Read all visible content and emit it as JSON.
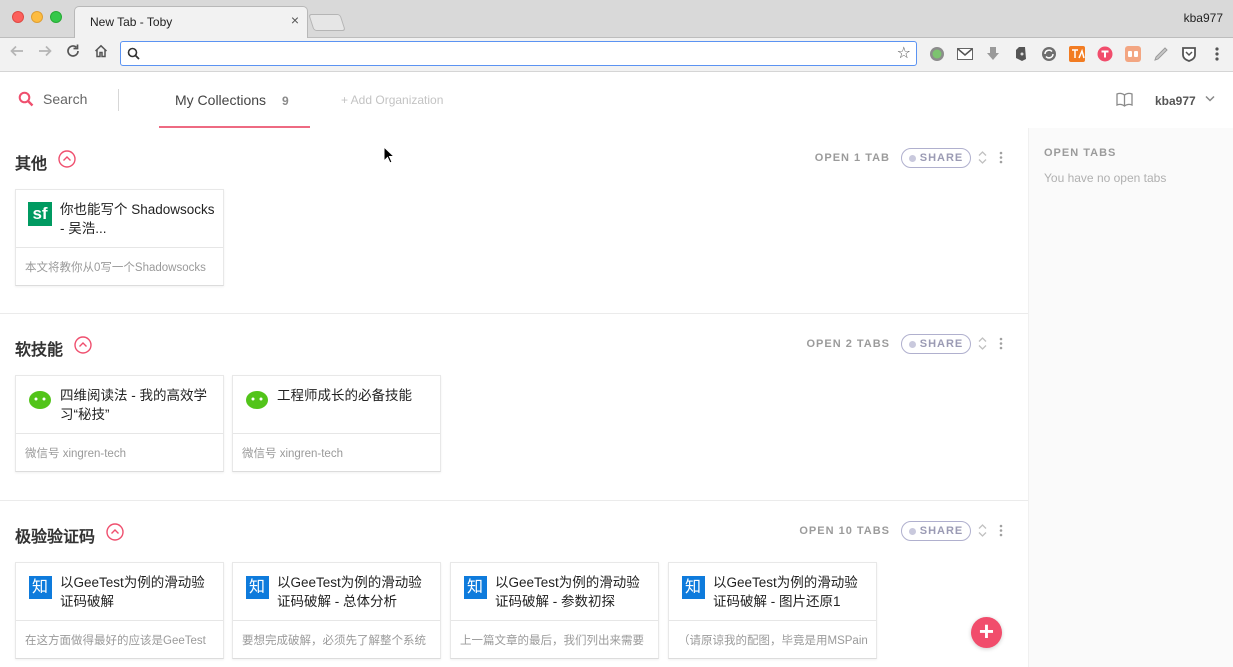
{
  "browser": {
    "tab_title": "New Tab - Toby",
    "tab_close": "×",
    "profile_name": "kba977",
    "address_value": "",
    "extension_icons": [
      "grammarly-icon",
      "gmail-icon",
      "download-icon",
      "evernote-icon",
      "sync-icon",
      "translate-icon",
      "toby-icon",
      "reader-icon",
      "highlighter-icon",
      "shield-icon"
    ]
  },
  "header": {
    "search_label": "Search",
    "collections_label": "My Collections",
    "collections_count": "9",
    "add_org_label": "+ Add Organization",
    "user_name": "kba977"
  },
  "collections": [
    {
      "title": "其他",
      "open_label": "OPEN 1 TAB",
      "share_label": "SHARE",
      "cards": [
        {
          "icon": "segmentfault-icon",
          "title": "你也能写个 Shadowsocks - 吴浩...",
          "desc": "本文将教你从0写一个Shadowsocks"
        }
      ]
    },
    {
      "title": "软技能",
      "open_label": "OPEN 2 TABS",
      "share_label": "SHARE",
      "cards": [
        {
          "icon": "wechat-icon",
          "title": "四维阅读法 - 我的高效学习“秘技”",
          "desc": "微信号 xingren-tech"
        },
        {
          "icon": "wechat-icon",
          "title": "工程师成长的必备技能",
          "desc": "微信号 xingren-tech"
        }
      ]
    },
    {
      "title": "极验验证码",
      "open_label": "OPEN 10 TABS",
      "share_label": "SHARE",
      "cards": [
        {
          "icon": "zhihu-icon",
          "title": "以GeeTest为例的滑动验证码破解",
          "desc": "在这方面做得最好的应该是GeeTest"
        },
        {
          "icon": "zhihu-icon",
          "title": "以GeeTest为例的滑动验证码破解 - 总体分析",
          "desc": "要想完成破解，必须先了解整个系统"
        },
        {
          "icon": "zhihu-icon",
          "title": "以GeeTest为例的滑动验证码破解 - 参数初探",
          "desc": "上一篇文章的最后，我们列出来需要"
        },
        {
          "icon": "zhihu-icon",
          "title": "以GeeTest为例的滑动验证码破解 - 图片还原1",
          "desc": "（请原谅我的配图，毕竟是用MSPaint"
        }
      ]
    }
  ],
  "right_panel": {
    "title": "OPEN TABS",
    "empty_text": "You have no open tabs"
  },
  "icons": {
    "sf_letter": "sf",
    "zhi_letter": "知",
    "fab": "+"
  },
  "colors": {
    "accent_pink": "#f14d6c",
    "tab_underline": "#ee6a82",
    "sf_green": "#009a61",
    "zhihu_blue": "#0e7bdc",
    "wechat_green": "#52c41a"
  }
}
